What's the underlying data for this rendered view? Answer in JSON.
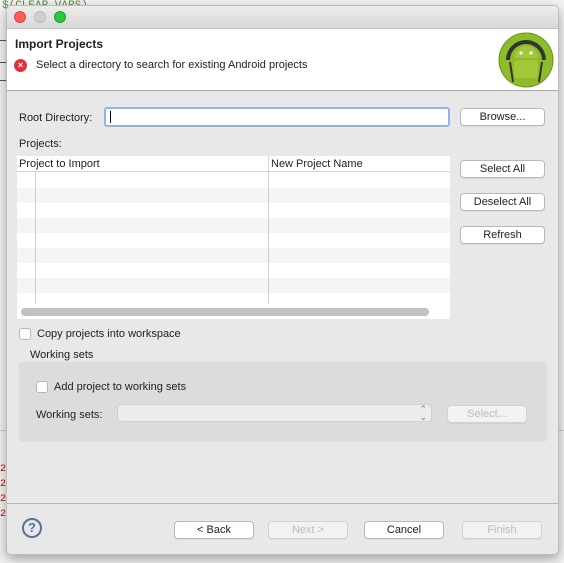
{
  "background": {
    "editor_fragment": "$(CLEAR_VARS)"
  },
  "window": {
    "traffic_lights": [
      "close",
      "minimize",
      "zoom"
    ]
  },
  "header": {
    "title": "Import Projects",
    "message": "Select a directory to search for existing Android projects",
    "message_icon": "error-icon",
    "logo": "android-logo"
  },
  "root_directory": {
    "label": "Root Directory:",
    "value": "",
    "browse_label": "Browse..."
  },
  "projects": {
    "label": "Projects:",
    "columns": [
      "Project to Import",
      "New Project Name"
    ],
    "rows": [],
    "select_all_label": "Select All",
    "deselect_all_label": "Deselect All",
    "refresh_label": "Refresh"
  },
  "copy_into_workspace": {
    "label": "Copy projects into workspace",
    "checked": false
  },
  "working_sets": {
    "group_label": "Working sets",
    "add_label": "Add project to working sets",
    "add_checked": false,
    "field_label": "Working sets:",
    "value": "",
    "select_label": "Select..."
  },
  "footer": {
    "back_label": "< Back",
    "next_label": "Next >",
    "cancel_label": "Cancel",
    "finish_label": "Finish"
  },
  "colors": {
    "accent": "#8db6e8",
    "error": "#e0343c",
    "android_green": "#a4c639"
  }
}
